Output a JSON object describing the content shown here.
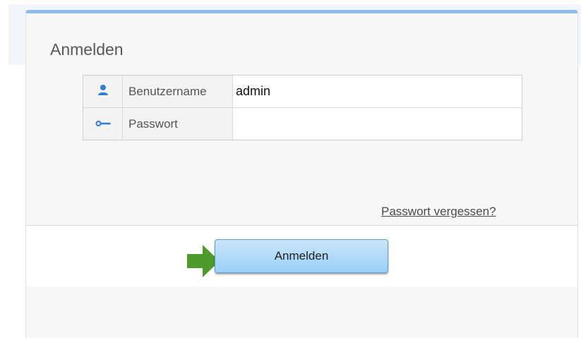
{
  "login": {
    "title": "Anmelden",
    "username": {
      "label": "Benutzername",
      "value": "admin",
      "icon": "user-icon"
    },
    "password": {
      "label": "Passwort",
      "value": "",
      "icon": "key-icon"
    },
    "forgot_link": "Passwort vergessen?",
    "submit_label": "Anmelden"
  },
  "colors": {
    "accent": "#8cbce8",
    "icon": "#2f7fd8",
    "arrow": "#4f9a2c",
    "button_top": "#cbe6fb",
    "button_bottom": "#9acff6"
  }
}
